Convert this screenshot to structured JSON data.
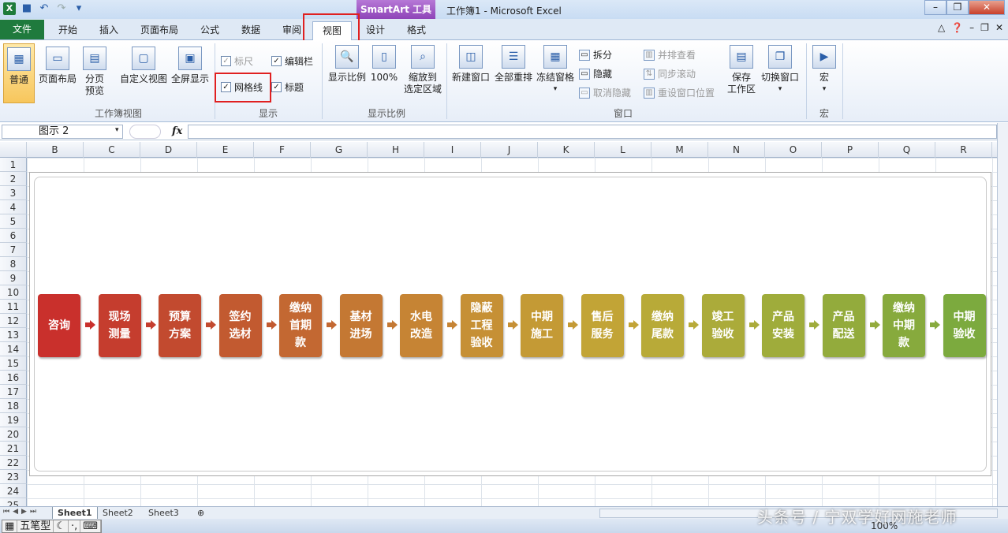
{
  "titlebar": {
    "contextual_tab": "SmartArt 工具",
    "doc_title": "工作簿1 - Microsoft Excel"
  },
  "tabs": [
    {
      "label": "文件"
    },
    {
      "label": "开始"
    },
    {
      "label": "插入"
    },
    {
      "label": "页面布局"
    },
    {
      "label": "公式"
    },
    {
      "label": "数据"
    },
    {
      "label": "审阅"
    },
    {
      "label": "视图"
    },
    {
      "label": "设计"
    },
    {
      "label": "格式"
    }
  ],
  "ribbon": {
    "workbook_views": {
      "label": "工作簿视图",
      "normal": "普通",
      "page_layout": "页面布局",
      "page_break_1": "分页",
      "page_break_2": "预览",
      "custom": "自定义视图",
      "fullscreen": "全屏显示"
    },
    "show": {
      "label": "显示",
      "ruler": "标尺",
      "formula_bar": "编辑栏",
      "gridlines": "网格线",
      "headings": "标题"
    },
    "zoom": {
      "label": "显示比例",
      "zoom": "显示比例",
      "hundred": "100%",
      "zoom_sel_1": "缩放到",
      "zoom_sel_2": "选定区域"
    },
    "window": {
      "label": "窗口",
      "new_window": "新建窗口",
      "arrange_all": "全部重排",
      "freeze": "冻结窗格",
      "split": "拆分",
      "hide": "隐藏",
      "unhide": "取消隐藏",
      "side_by_side": "并排查看",
      "sync_scroll": "同步滚动",
      "reset_pos": "重设窗口位置",
      "save_ws_1": "保存",
      "save_ws_2": "工作区",
      "switch": "切换窗口"
    },
    "macro": {
      "label": "宏",
      "macros": "宏"
    }
  },
  "formula_bar": {
    "name_box": "图示 2",
    "fx": "fx"
  },
  "columns": [
    "B",
    "C",
    "D",
    "E",
    "F",
    "G",
    "H",
    "I",
    "J",
    "K",
    "L",
    "M",
    "N",
    "O",
    "P",
    "Q",
    "R"
  ],
  "rows": [
    "1",
    "2",
    "3",
    "4",
    "5",
    "6",
    "7",
    "8",
    "9",
    "10",
    "11",
    "12",
    "13",
    "14",
    "15",
    "16",
    "17",
    "18",
    "19",
    "20",
    "21",
    "22",
    "23",
    "24",
    "25"
  ],
  "smartart": {
    "steps": [
      {
        "text": "咨询",
        "color": "#c9302c"
      },
      {
        "text": "现场测量",
        "color": "#c53d2e"
      },
      {
        "text": "预算方案",
        "color": "#c24a2f"
      },
      {
        "text": "签约选材",
        "color": "#c25a30"
      },
      {
        "text": "缴纳首期款",
        "color": "#c36832"
      },
      {
        "text": "基材进场",
        "color": "#c47833"
      },
      {
        "text": "水电改造",
        "color": "#c68434"
      },
      {
        "text": "隐蔽工程验收",
        "color": "#c69035"
      },
      {
        "text": "中期施工",
        "color": "#c49a35"
      },
      {
        "text": "售后服务",
        "color": "#c2a436"
      },
      {
        "text": "缴纳尾款",
        "color": "#b8aa38"
      },
      {
        "text": "竣工验收",
        "color": "#abab3a"
      },
      {
        "text": "产品安装",
        "color": "#9fac3b"
      },
      {
        "text": "产品配送",
        "color": "#93ab3c"
      },
      {
        "text": "缴纳中期款",
        "color": "#87aa3d"
      },
      {
        "text": "中期验收",
        "color": "#7caa3e"
      }
    ]
  },
  "sheets": [
    "Sheet1",
    "Sheet2",
    "Sheet3"
  ],
  "statusbar": {
    "ime_name": "五笔型",
    "zoom": "100%"
  },
  "watermark": "头条号 / 宁双学好网施老师"
}
